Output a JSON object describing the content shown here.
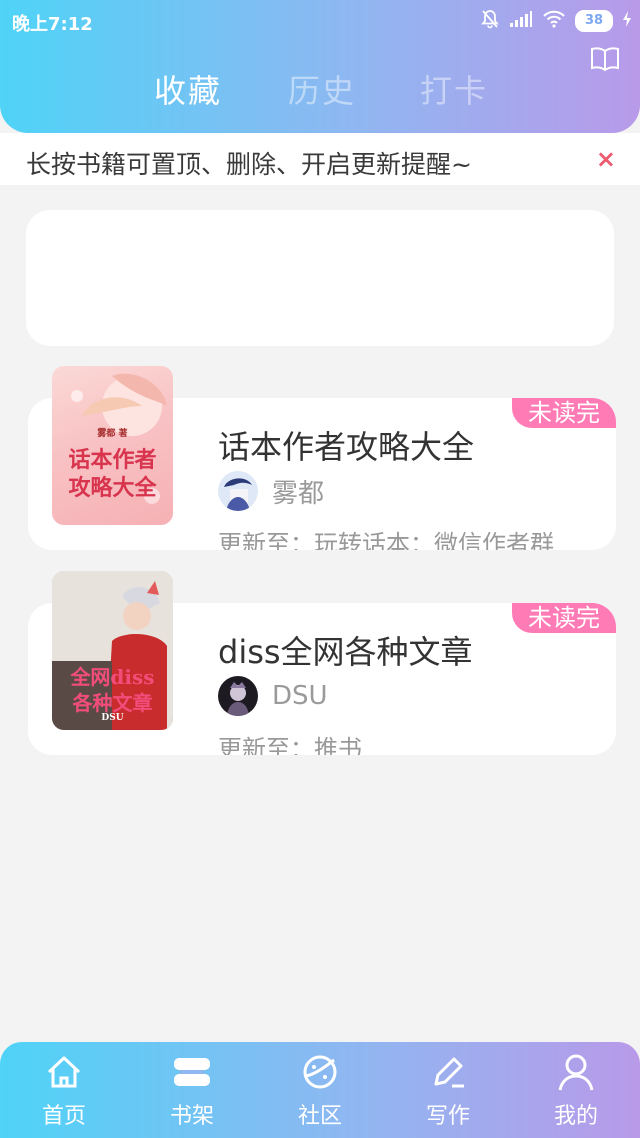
{
  "status_bar": {
    "time": "晚上7:12",
    "battery": "38"
  },
  "header": {
    "tabs": [
      {
        "label": "收藏",
        "active": true
      },
      {
        "label": "历史",
        "active": false
      },
      {
        "label": "打卡",
        "active": false
      }
    ],
    "icon": "book-icon"
  },
  "notice": {
    "text": "长按书籍可置顶、删除、开启更新提醒~",
    "close": "×"
  },
  "books": [
    {
      "title": "话本作者攻略大全",
      "author": "雾都",
      "update": "更新至：玩转话本：微信作者群",
      "badge": "未读完",
      "cover_text": [
        "话本作者",
        "攻略大全"
      ],
      "cover_small": "雾都 著"
    },
    {
      "title": "diss全网各种文章",
      "author": "DSU",
      "update": "更新至：推书",
      "badge": "未读完",
      "cover_text": [
        "全网diss",
        "各种文章"
      ],
      "cover_small": "DSU"
    }
  ],
  "bottom_nav": [
    {
      "label": "首页",
      "icon": "home-icon"
    },
    {
      "label": "书架",
      "icon": "bookshelf-icon"
    },
    {
      "label": "社区",
      "icon": "planet-icon"
    },
    {
      "label": "写作",
      "icon": "pen-icon"
    },
    {
      "label": "我的",
      "icon": "user-icon"
    }
  ],
  "colors": {
    "gradient_start": "#4fd3f7",
    "gradient_end": "#b89ae9",
    "badge": "#ff7bb5",
    "close": "#ee5a6e"
  }
}
